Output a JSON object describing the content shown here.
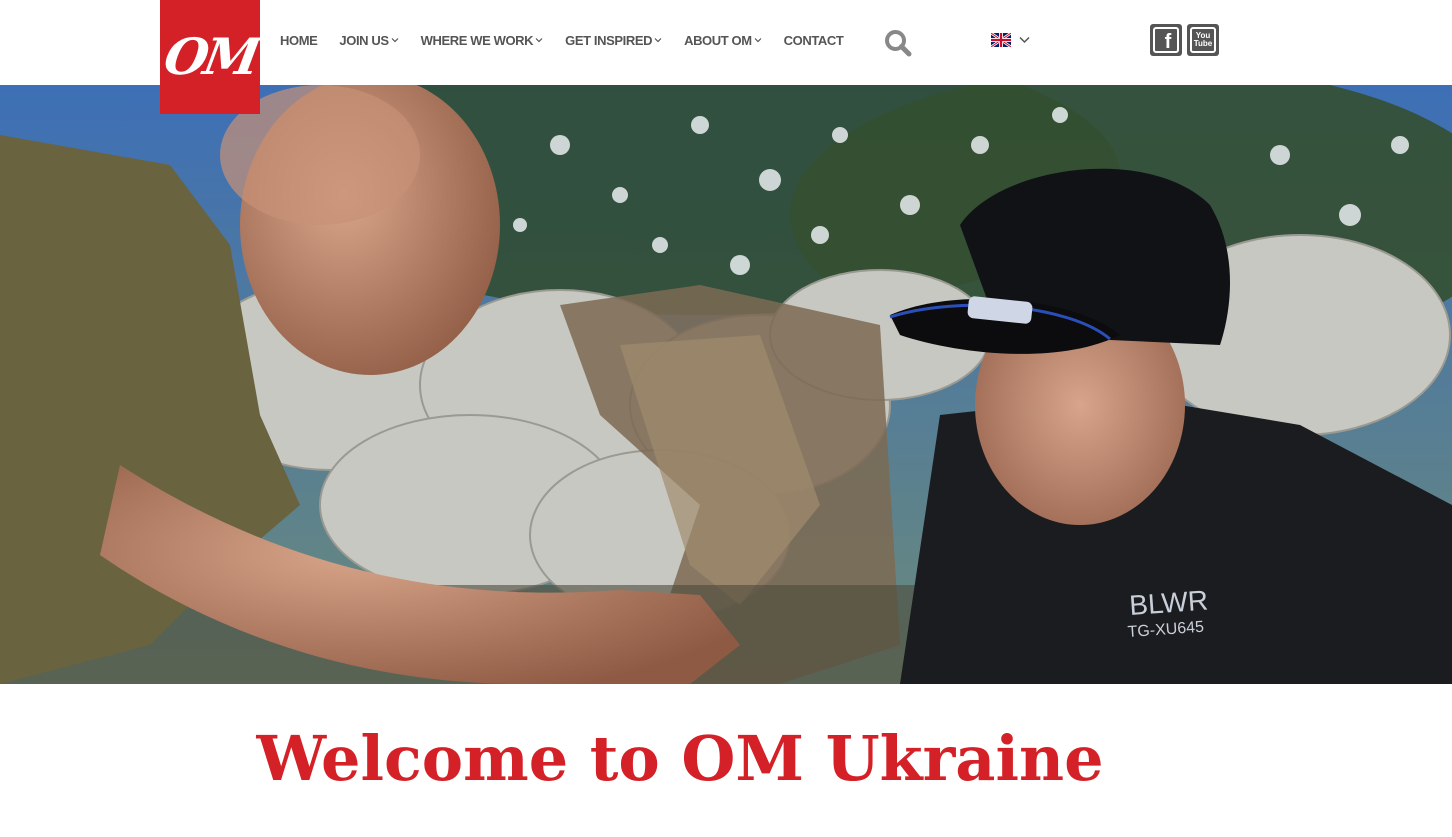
{
  "logo": {
    "text": "OM",
    "color": "#d42027"
  },
  "nav": {
    "items": [
      {
        "label": "HOME",
        "has_dropdown": false
      },
      {
        "label": "JOIN US",
        "has_dropdown": true
      },
      {
        "label": "WHERE WE WORK",
        "has_dropdown": true
      },
      {
        "label": "GET INSPIRED",
        "has_dropdown": true
      },
      {
        "label": "ABOUT OM",
        "has_dropdown": true
      },
      {
        "label": "CONTACT",
        "has_dropdown": false
      }
    ]
  },
  "icons": {
    "search": "search-icon",
    "language": "uk-flag-icon",
    "facebook": "facebook-icon",
    "youtube": "youtube-icon"
  },
  "social": {
    "facebook_glyph": "f",
    "youtube_line1": "You",
    "youtube_line2": "Tube"
  },
  "hero": {
    "shirt_text_line1": "BLWR",
    "shirt_text_line2": "TG-XU645"
  },
  "main": {
    "heading": "Welcome to OM Ukraine"
  },
  "colors": {
    "accent": "#d42027",
    "nav_text": "#555555",
    "social_bg": "#555555"
  }
}
